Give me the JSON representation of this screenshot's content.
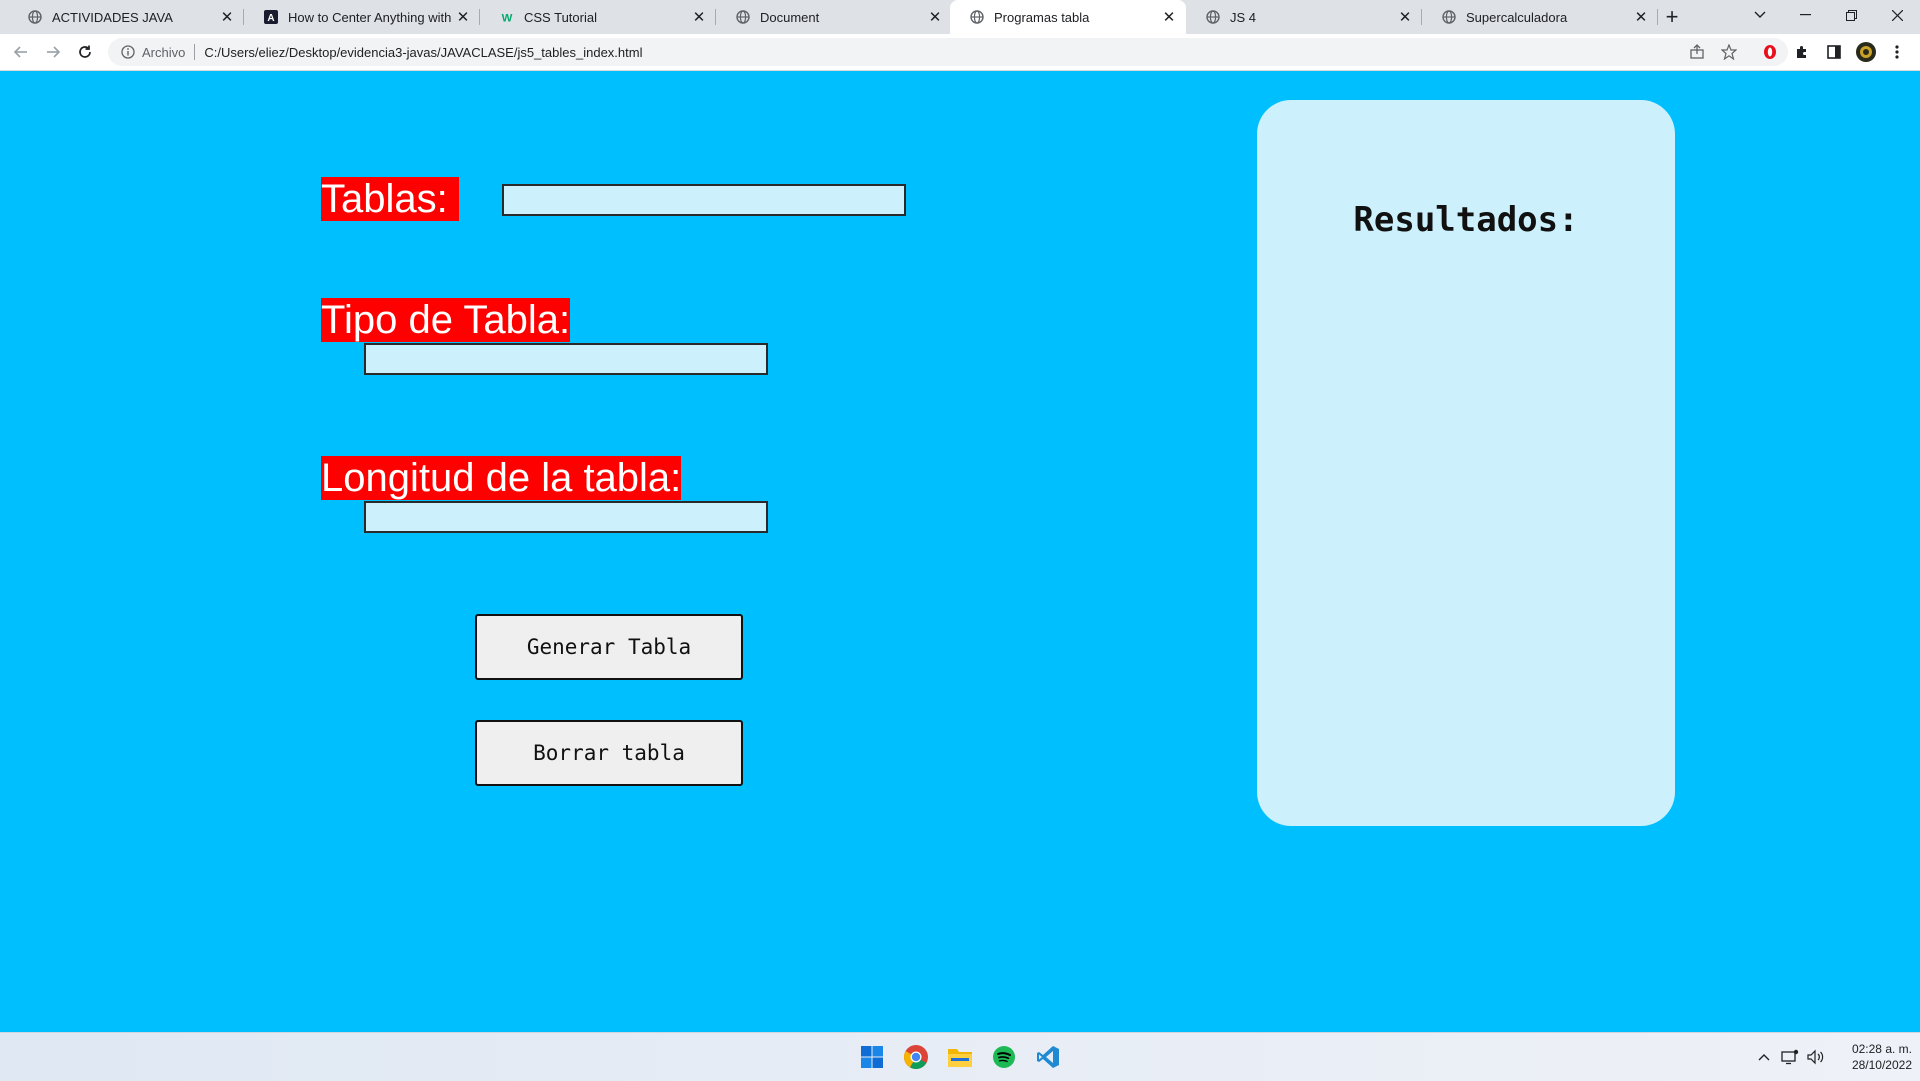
{
  "browser": {
    "tabs": [
      {
        "title": "ACTIVIDADES JAVA",
        "icon": "globe-icon",
        "active": false
      },
      {
        "title": "How to Center Anything with CS",
        "icon": "css-tricks-icon",
        "active": false
      },
      {
        "title": "CSS Tutorial",
        "icon": "w3schools-icon",
        "active": false
      },
      {
        "title": "Document",
        "icon": "globe-icon",
        "active": false
      },
      {
        "title": "Programas tabla",
        "icon": "globe-icon",
        "active": true
      },
      {
        "title": "JS 4",
        "icon": "globe-icon",
        "active": false
      },
      {
        "title": "Supercalculadora",
        "icon": "globe-icon",
        "active": false
      }
    ],
    "address": {
      "scheme_label": "Archivo",
      "url": "C:/Users/eliez/Desktop/evidencia3-javas/JAVACLASE/js5_tables_index.html"
    }
  },
  "form": {
    "tablas_label": "Tablas:",
    "tablas_value": "",
    "tipo_label": "Tipo de Tabla:",
    "tipo_value": "",
    "longitud_label": "Longitud de la tabla:",
    "longitud_value": "",
    "generate_button": "Generar Tabla",
    "clear_button": "Borrar tabla"
  },
  "results": {
    "title": "Resultados:"
  },
  "taskbar": {
    "apps": [
      "windows-start-icon",
      "chrome-icon",
      "file-explorer-icon",
      "spotify-icon",
      "vscode-icon"
    ],
    "time": "02:28 a. m.",
    "date": "28/10/2022"
  },
  "colors": {
    "page_background": "#00bfff",
    "label_background": "#ff0000",
    "input_background": "#ccf0fc",
    "results_panel": "#ccf0fc"
  }
}
